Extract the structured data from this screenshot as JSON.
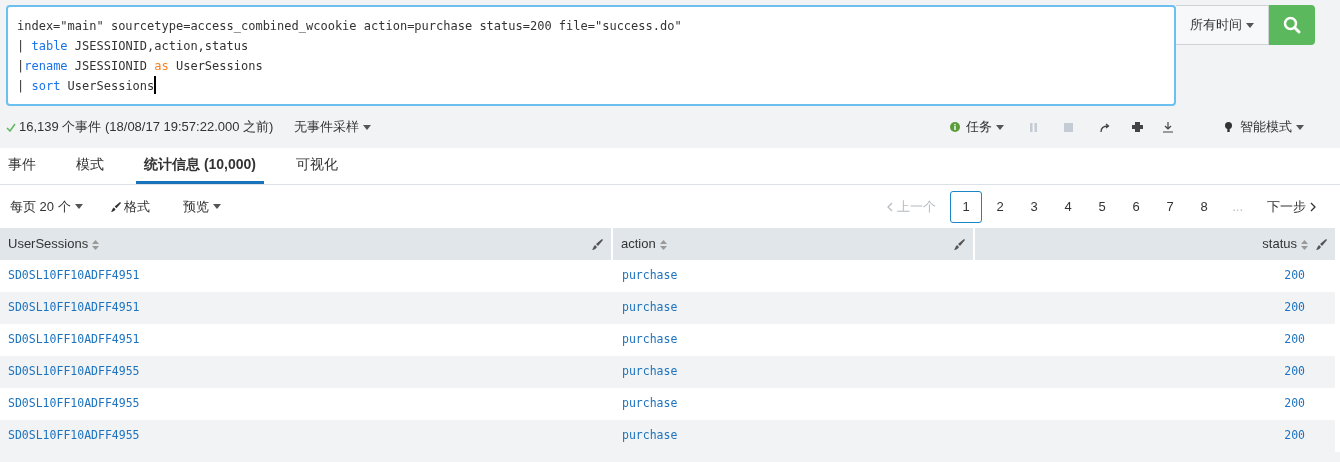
{
  "search": {
    "lines": [
      [
        {
          "text": "index=\"main\" sourcetype=access_combined_wcookie action=purchase status=200 file=\"success.do\"",
          "kind": "plain"
        }
      ],
      [
        {
          "text": "| ",
          "kind": "plain"
        },
        {
          "text": "table",
          "kind": "command"
        },
        {
          "text": " JSESSIONID,action,status",
          "kind": "plain"
        }
      ],
      [
        {
          "text": "|",
          "kind": "plain"
        },
        {
          "text": "rename",
          "kind": "command"
        },
        {
          "text": " JSESSIONID ",
          "kind": "plain"
        },
        {
          "text": "as",
          "kind": "keyword"
        },
        {
          "text": " UserSessions",
          "kind": "plain"
        }
      ],
      [
        {
          "text": "| ",
          "kind": "plain"
        },
        {
          "text": "sort",
          "kind": "command"
        },
        {
          "text": " UserSessions",
          "kind": "plain"
        }
      ]
    ],
    "time_range": "所有时间"
  },
  "status": {
    "summary": "16,139 个事件 (18/08/17 19:57:22.000 之前)",
    "sampling": "无事件采样",
    "job": "任务",
    "mode": "智能模式"
  },
  "tabs": [
    {
      "label": "事件",
      "selected": false
    },
    {
      "label": "模式",
      "selected": false
    },
    {
      "label": "统计信息 (10,000)",
      "selected": true
    },
    {
      "label": "可视化",
      "selected": false
    }
  ],
  "toolbar": {
    "per_page": "每页 20 个",
    "format": "格式",
    "preview": "预览"
  },
  "pagination": {
    "prev": "上一个",
    "next": "下一步",
    "ellipsis": "...",
    "pages": [
      {
        "label": "1",
        "selected": true
      },
      {
        "label": "2",
        "selected": false
      },
      {
        "label": "3",
        "selected": false
      },
      {
        "label": "4",
        "selected": false
      },
      {
        "label": "5",
        "selected": false
      },
      {
        "label": "6",
        "selected": false
      },
      {
        "label": "7",
        "selected": false
      },
      {
        "label": "8",
        "selected": false
      }
    ]
  },
  "table": {
    "columns": [
      "UserSessions",
      "action",
      "status"
    ],
    "rows": [
      [
        "SD0SL10FF10ADFF4951",
        "purchase",
        "200"
      ],
      [
        "SD0SL10FF10ADFF4951",
        "purchase",
        "200"
      ],
      [
        "SD0SL10FF10ADFF4951",
        "purchase",
        "200"
      ],
      [
        "SD0SL10FF10ADFF4955",
        "purchase",
        "200"
      ],
      [
        "SD0SL10FF10ADFF4955",
        "purchase",
        "200"
      ],
      [
        "SD0SL10FF10ADFF4955",
        "purchase",
        "200"
      ]
    ]
  }
}
